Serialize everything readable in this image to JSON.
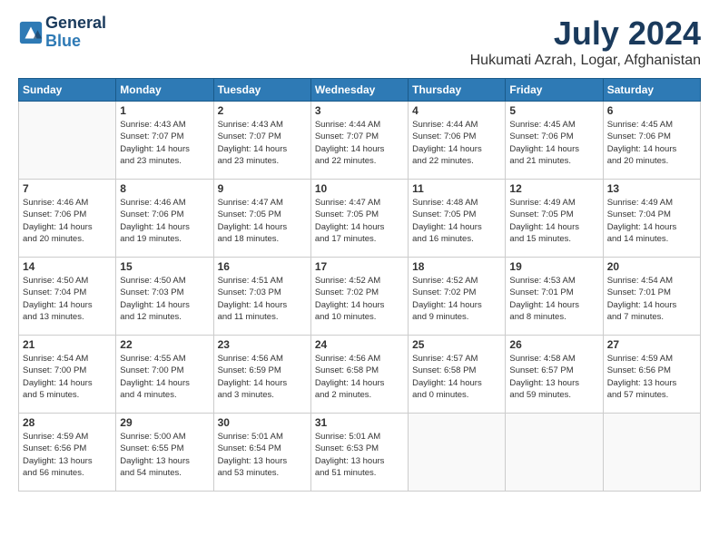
{
  "header": {
    "logo_line1": "General",
    "logo_line2": "Blue",
    "month": "July 2024",
    "location": "Hukumati Azrah, Logar, Afghanistan"
  },
  "weekdays": [
    "Sunday",
    "Monday",
    "Tuesday",
    "Wednesday",
    "Thursday",
    "Friday",
    "Saturday"
  ],
  "weeks": [
    [
      {
        "day": "",
        "info": ""
      },
      {
        "day": "1",
        "info": "Sunrise: 4:43 AM\nSunset: 7:07 PM\nDaylight: 14 hours\nand 23 minutes."
      },
      {
        "day": "2",
        "info": "Sunrise: 4:43 AM\nSunset: 7:07 PM\nDaylight: 14 hours\nand 23 minutes."
      },
      {
        "day": "3",
        "info": "Sunrise: 4:44 AM\nSunset: 7:07 PM\nDaylight: 14 hours\nand 22 minutes."
      },
      {
        "day": "4",
        "info": "Sunrise: 4:44 AM\nSunset: 7:06 PM\nDaylight: 14 hours\nand 22 minutes."
      },
      {
        "day": "5",
        "info": "Sunrise: 4:45 AM\nSunset: 7:06 PM\nDaylight: 14 hours\nand 21 minutes."
      },
      {
        "day": "6",
        "info": "Sunrise: 4:45 AM\nSunset: 7:06 PM\nDaylight: 14 hours\nand 20 minutes."
      }
    ],
    [
      {
        "day": "7",
        "info": "Sunrise: 4:46 AM\nSunset: 7:06 PM\nDaylight: 14 hours\nand 20 minutes."
      },
      {
        "day": "8",
        "info": "Sunrise: 4:46 AM\nSunset: 7:06 PM\nDaylight: 14 hours\nand 19 minutes."
      },
      {
        "day": "9",
        "info": "Sunrise: 4:47 AM\nSunset: 7:05 PM\nDaylight: 14 hours\nand 18 minutes."
      },
      {
        "day": "10",
        "info": "Sunrise: 4:47 AM\nSunset: 7:05 PM\nDaylight: 14 hours\nand 17 minutes."
      },
      {
        "day": "11",
        "info": "Sunrise: 4:48 AM\nSunset: 7:05 PM\nDaylight: 14 hours\nand 16 minutes."
      },
      {
        "day": "12",
        "info": "Sunrise: 4:49 AM\nSunset: 7:05 PM\nDaylight: 14 hours\nand 15 minutes."
      },
      {
        "day": "13",
        "info": "Sunrise: 4:49 AM\nSunset: 7:04 PM\nDaylight: 14 hours\nand 14 minutes."
      }
    ],
    [
      {
        "day": "14",
        "info": "Sunrise: 4:50 AM\nSunset: 7:04 PM\nDaylight: 14 hours\nand 13 minutes."
      },
      {
        "day": "15",
        "info": "Sunrise: 4:50 AM\nSunset: 7:03 PM\nDaylight: 14 hours\nand 12 minutes."
      },
      {
        "day": "16",
        "info": "Sunrise: 4:51 AM\nSunset: 7:03 PM\nDaylight: 14 hours\nand 11 minutes."
      },
      {
        "day": "17",
        "info": "Sunrise: 4:52 AM\nSunset: 7:02 PM\nDaylight: 14 hours\nand 10 minutes."
      },
      {
        "day": "18",
        "info": "Sunrise: 4:52 AM\nSunset: 7:02 PM\nDaylight: 14 hours\nand 9 minutes."
      },
      {
        "day": "19",
        "info": "Sunrise: 4:53 AM\nSunset: 7:01 PM\nDaylight: 14 hours\nand 8 minutes."
      },
      {
        "day": "20",
        "info": "Sunrise: 4:54 AM\nSunset: 7:01 PM\nDaylight: 14 hours\nand 7 minutes."
      }
    ],
    [
      {
        "day": "21",
        "info": "Sunrise: 4:54 AM\nSunset: 7:00 PM\nDaylight: 14 hours\nand 5 minutes."
      },
      {
        "day": "22",
        "info": "Sunrise: 4:55 AM\nSunset: 7:00 PM\nDaylight: 14 hours\nand 4 minutes."
      },
      {
        "day": "23",
        "info": "Sunrise: 4:56 AM\nSunset: 6:59 PM\nDaylight: 14 hours\nand 3 minutes."
      },
      {
        "day": "24",
        "info": "Sunrise: 4:56 AM\nSunset: 6:58 PM\nDaylight: 14 hours\nand 2 minutes."
      },
      {
        "day": "25",
        "info": "Sunrise: 4:57 AM\nSunset: 6:58 PM\nDaylight: 14 hours\nand 0 minutes."
      },
      {
        "day": "26",
        "info": "Sunrise: 4:58 AM\nSunset: 6:57 PM\nDaylight: 13 hours\nand 59 minutes."
      },
      {
        "day": "27",
        "info": "Sunrise: 4:59 AM\nSunset: 6:56 PM\nDaylight: 13 hours\nand 57 minutes."
      }
    ],
    [
      {
        "day": "28",
        "info": "Sunrise: 4:59 AM\nSunset: 6:56 PM\nDaylight: 13 hours\nand 56 minutes."
      },
      {
        "day": "29",
        "info": "Sunrise: 5:00 AM\nSunset: 6:55 PM\nDaylight: 13 hours\nand 54 minutes."
      },
      {
        "day": "30",
        "info": "Sunrise: 5:01 AM\nSunset: 6:54 PM\nDaylight: 13 hours\nand 53 minutes."
      },
      {
        "day": "31",
        "info": "Sunrise: 5:01 AM\nSunset: 6:53 PM\nDaylight: 13 hours\nand 51 minutes."
      },
      {
        "day": "",
        "info": ""
      },
      {
        "day": "",
        "info": ""
      },
      {
        "day": "",
        "info": ""
      }
    ]
  ]
}
